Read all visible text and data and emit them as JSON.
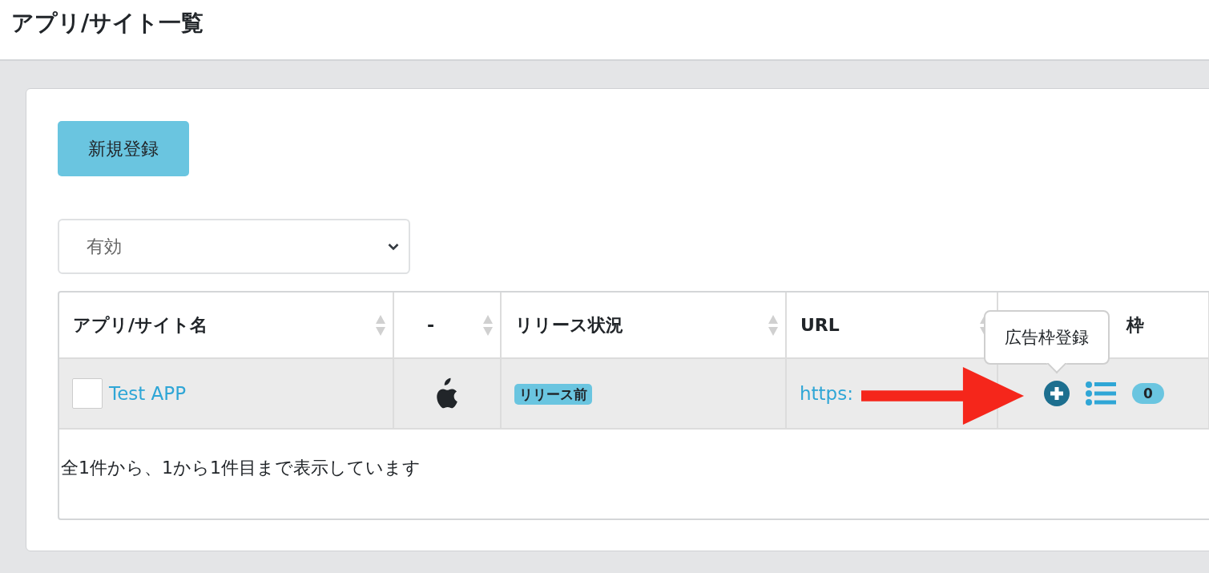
{
  "page_title": "アプリ/サイト一覧",
  "new_button": "新規登録",
  "filter": {
    "value": "有効"
  },
  "table": {
    "columns": [
      {
        "label": "アプリ/サイト名",
        "sortable": true
      },
      {
        "label": "-",
        "sortable": true
      },
      {
        "label": "リリース状況",
        "sortable": true
      },
      {
        "label": "URL",
        "sortable": true
      },
      {
        "label": "枠",
        "sortable": false
      }
    ],
    "rows": [
      {
        "name": "Test APP",
        "status": "リリース前",
        "url": "https:",
        "ad_count": "0"
      }
    ],
    "footer": "全1件から、1から1件目まで表示しています"
  },
  "tooltip": "広告枠登録",
  "annotation": {
    "kind": "arrow"
  }
}
